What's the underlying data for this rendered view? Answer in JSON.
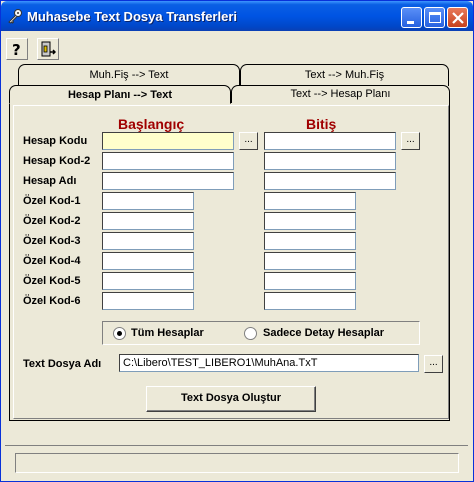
{
  "window": {
    "title": "Muhasebe Text Dosya Transferleri",
    "app_icon": "key-icon",
    "colors": {
      "titlebar": "#0054e3",
      "header_text": "#a00000",
      "highlight_field": "#ffffcc"
    }
  },
  "toolbar": {
    "help_icon": "question-mark-icon",
    "exit_icon": "exit-door-icon"
  },
  "tabs": {
    "back_row": [
      "Muh.Fiş --> Text",
      "Text --> Muh.Fiş"
    ],
    "front_row": [
      "Hesap Planı --> Text",
      "Text --> Hesap Planı"
    ],
    "active": "Hesap Planı --> Text"
  },
  "form": {
    "start_header": "Başlangıç",
    "end_header": "Bitiş",
    "rows": [
      {
        "label": "Hesap Kodu",
        "start": "",
        "end": ""
      },
      {
        "label": "Hesap Kod-2",
        "start": "",
        "end": ""
      },
      {
        "label": "Hesap Adı",
        "start": "",
        "end": ""
      },
      {
        "label": "Özel Kod-1",
        "start": "",
        "end": ""
      },
      {
        "label": "Özel Kod-2",
        "start": "",
        "end": ""
      },
      {
        "label": "Özel Kod-3",
        "start": "",
        "end": ""
      },
      {
        "label": "Özel Kod-4",
        "start": "",
        "end": ""
      },
      {
        "label": "Özel Kod-5",
        "start": "",
        "end": ""
      },
      {
        "label": "Özel Kod-6",
        "start": "",
        "end": ""
      }
    ],
    "browse_label": "...",
    "radio_options": [
      "Tüm Hesaplar",
      "Sadece Detay Hesaplar"
    ],
    "radio_selected": "Tüm Hesaplar",
    "file_label": "Text Dosya Adı",
    "file_value": "C:\\Libero\\TEST_LIBERO1\\MuhAna.TxT",
    "create_button": "Text Dosya Oluştur"
  },
  "status": {
    "text": ""
  }
}
